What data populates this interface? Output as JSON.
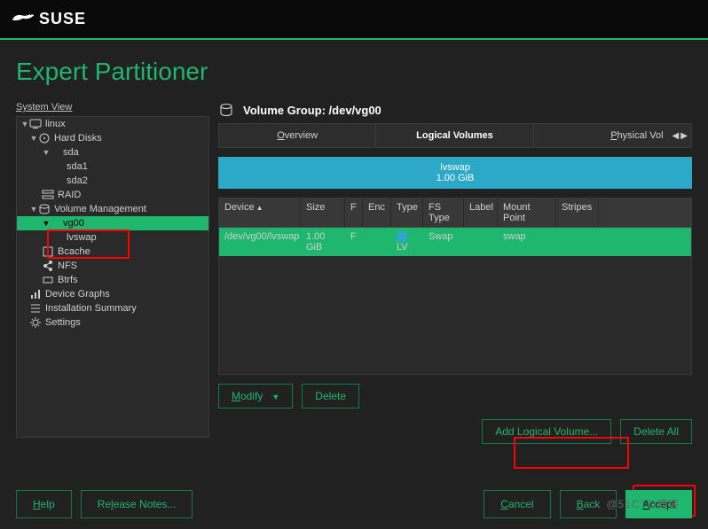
{
  "header": {
    "brand": "SUSE"
  },
  "title": "Expert Partitioner",
  "left": {
    "system_view_label": "System View",
    "tree": {
      "root": "linux",
      "hard_disks": "Hard Disks",
      "sda": "sda",
      "sda1": "sda1",
      "sda2": "sda2",
      "raid": "RAID",
      "volume_mgmt": "Volume Management",
      "vg00": "vg00",
      "lvswap": "lvswap",
      "bcache": "Bcache",
      "nfs": "NFS",
      "btrfs": "Btrfs",
      "device_graphs": "Device Graphs",
      "install_summary": "Installation Summary",
      "settings": "Settings"
    }
  },
  "right": {
    "vg_title": "Volume Group: /dev/vg00",
    "tabs": {
      "overview": "Overview",
      "overview_u": "O",
      "logical": "Logical Volumes",
      "physical": "Physical Vol",
      "physical_u": "P"
    },
    "usage": {
      "name": "lvswap",
      "size": "1.00 GiB"
    },
    "table": {
      "headers": {
        "device": "Device",
        "size": "Size",
        "f": "F",
        "enc": "Enc",
        "type": "Type",
        "fs": "FS Type",
        "label": "Label",
        "mount": "Mount Point",
        "stripes": "Stripes"
      },
      "rows": [
        {
          "device": "/dev/vg00/lvswap",
          "size": "1.00 GiB",
          "f": "F",
          "enc": "",
          "type": "LV",
          "fs": "Swap",
          "label": "",
          "mount": "swap",
          "stripes": ""
        }
      ]
    },
    "buttons": {
      "modify": "Modify",
      "modify_u": "M",
      "delete": "Delete",
      "add_lv": "Add Logical Volume...",
      "delete_all": "Delete All"
    }
  },
  "bottom": {
    "help": "Help",
    "help_u": "H",
    "notes": "Release Notes...",
    "notes_u": "l",
    "cancel": "Cancel",
    "cancel_u": "C",
    "back": "Back",
    "back_u": "B",
    "accept": "Accept",
    "accept_u": "A"
  },
  "watermark": "@51CTO博客"
}
